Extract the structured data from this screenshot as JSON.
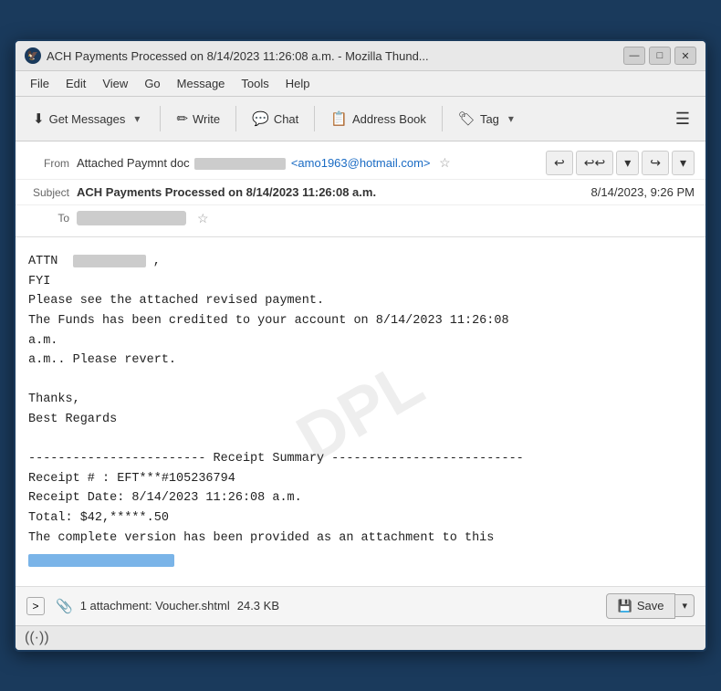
{
  "window": {
    "title": "ACH Payments Processed on 8/14/2023 11:26:08 a.m. - Mozilla Thund...",
    "icon": "🔵"
  },
  "titlebar": {
    "minimize_label": "—",
    "maximize_label": "□",
    "close_label": "✕"
  },
  "menubar": {
    "items": [
      "File",
      "Edit",
      "View",
      "Go",
      "Message",
      "Tools",
      "Help"
    ]
  },
  "toolbar": {
    "get_messages_label": "Get Messages",
    "write_label": "Write",
    "chat_label": "Chat",
    "address_book_label": "Address Book",
    "tag_label": "Tag",
    "hamburger_label": "☰"
  },
  "email": {
    "from_label": "From",
    "from_name": "Attached Paymnt doc",
    "from_email": "<amo1963@hotmail.com>",
    "subject_label": "Subject",
    "subject": "ACH Payments Processed on 8/14/2023 11:26:08 a.m.",
    "date": "8/14/2023, 9:26 PM",
    "to_label": "To",
    "body_lines": [
      "",
      "FYI",
      "Please see the attached revised payment.",
      "The Funds has been credited to your account on 8/14/2023 11:26:08",
      "a.m.",
      "a.m.. Please revert.",
      "",
      "Thanks,",
      "Best Regards",
      "",
      "------------------------ Receipt Summary --------------------------",
      "Receipt # : EFT***#105236794",
      "Receipt Date: 8/14/2023 11:26:08 a.m.",
      "Total: $42,*****.50",
      "The complete version has been  provided as an attachment to  this"
    ]
  },
  "attachment": {
    "count": "1 attachment: Voucher.shtml",
    "size": "24.3 KB",
    "save_label": "Save"
  },
  "statusbar": {
    "wifi_icon": "((·))"
  }
}
